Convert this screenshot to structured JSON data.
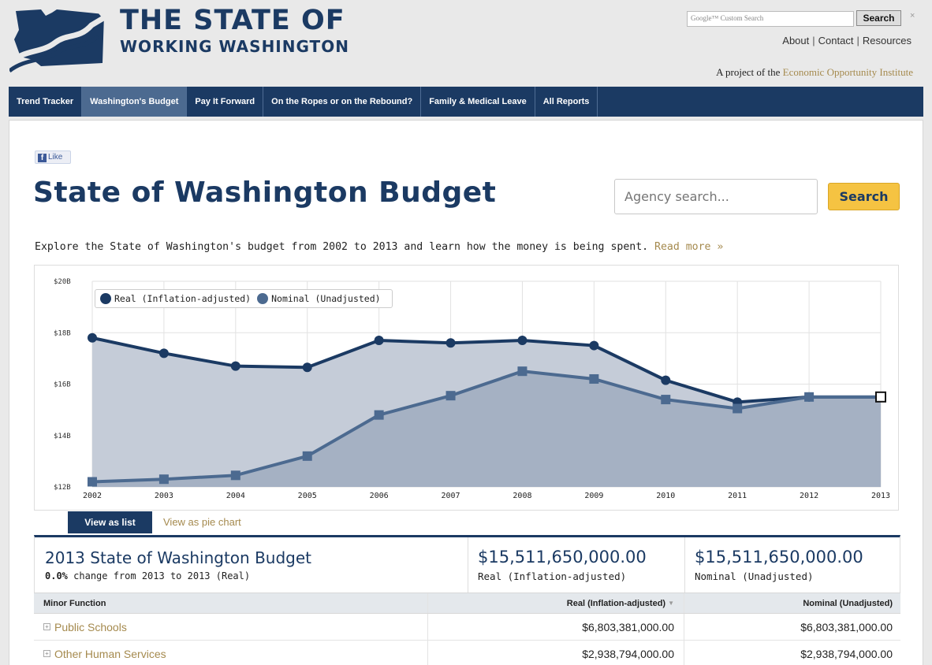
{
  "header": {
    "logo_line1": "THE STATE OF",
    "logo_line2": "WORKING WASHINGTON",
    "google_search_placeholder": "Google™ Custom Search",
    "google_search_button": "Search",
    "google_search_close": "×",
    "links": [
      "About",
      "Contact",
      "Resources"
    ],
    "link_separator": "|",
    "project_prefix": "A project of the",
    "project_org": "Economic Opportunity Institute"
  },
  "nav": {
    "items": [
      {
        "label": "Trend Tracker",
        "active": false
      },
      {
        "label": "Washington's Budget",
        "active": true
      },
      {
        "label": "Pay It Forward",
        "active": false
      },
      {
        "label": "On the Ropes or on the Rebound?",
        "active": false
      },
      {
        "label": "Family & Medical Leave",
        "active": false
      },
      {
        "label": "All Reports",
        "active": false
      }
    ]
  },
  "social": {
    "like_icon": "f",
    "like_label": "Like"
  },
  "page": {
    "title": "State of Washington Budget",
    "agency_search_placeholder": "Agency search...",
    "agency_search_button": "Search",
    "intro": "Explore the State of Washington's budget from 2002 to 2013 and learn how the money is being spent.",
    "read_more": "Read more »"
  },
  "chart_data": {
    "type": "area",
    "x": [
      "2002",
      "2003",
      "2004",
      "2005",
      "2006",
      "2007",
      "2008",
      "2009",
      "2010",
      "2011",
      "2012",
      "2013"
    ],
    "yticks": [
      "$12B",
      "$14B",
      "$16B",
      "$18B",
      "$20B"
    ],
    "ylim": [
      12,
      20
    ],
    "yunit": "billions of dollars",
    "grid": true,
    "legend_position": "top-left",
    "series": [
      {
        "name": "Real (Inflation-adjusted)",
        "color": "#1b3a63",
        "marker": "circle",
        "values": [
          17.8,
          17.2,
          16.7,
          16.65,
          17.7,
          17.6,
          17.7,
          17.5,
          16.15,
          15.3,
          15.5,
          15.5
        ]
      },
      {
        "name": "Nominal (Unadjusted)",
        "color": "#4c6a90",
        "marker": "square",
        "values": [
          12.2,
          12.3,
          12.45,
          13.2,
          14.8,
          15.55,
          16.5,
          16.2,
          15.4,
          15.05,
          15.5,
          15.5
        ]
      }
    ]
  },
  "tabs": {
    "list": "View as list",
    "pie": "View as pie chart"
  },
  "summary": {
    "title": "2013 State of Washington Budget",
    "change_value": "0.0%",
    "change_text": "change from 2013 to 2013 (Real)",
    "real_amount": "$15,511,650,000.00",
    "real_label": "Real (Inflation-adjusted)",
    "nominal_amount": "$15,511,650,000.00",
    "nominal_label": "Nominal (Unadjusted)"
  },
  "table": {
    "headers": [
      "Minor Function",
      "Real (Inflation-adjusted)",
      "Nominal (Unadjusted)"
    ],
    "sort_indicator": "▼",
    "expand_icon": "+",
    "rows": [
      {
        "name": "Public Schools",
        "real": "$6,803,381,000.00",
        "nominal": "$6,803,381,000.00"
      },
      {
        "name": "Other Human Services",
        "real": "$2,938,794,000.00",
        "nominal": "$2,938,794,000.00"
      }
    ]
  },
  "colors": {
    "brand_navy": "#1b3a63",
    "nav_active": "#4c6a90",
    "link_gold": "#a58a4e",
    "button_yellow": "#f5c342"
  }
}
